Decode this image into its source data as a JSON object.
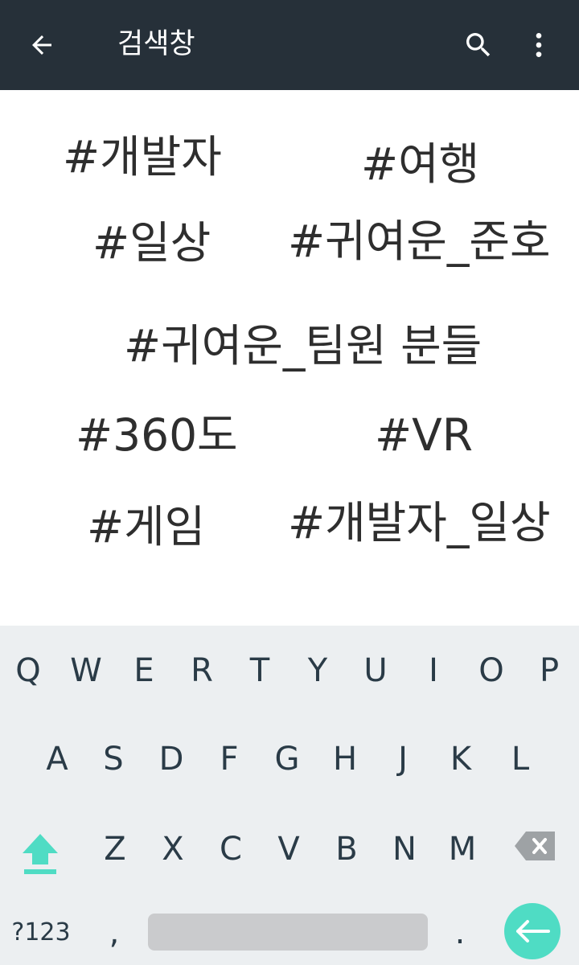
{
  "app_bar": {
    "title": "검색창",
    "back_icon": "arrow-left-icon",
    "search_icon": "search-icon",
    "more_icon": "more-vert-icon",
    "background": "#263039"
  },
  "tags": [
    "#개발자",
    "#여행",
    "#일상",
    "#귀여운_준호",
    "#귀여운_팀원 분들",
    "#360도",
    "#VR",
    "#게임",
    "#개발자_일상"
  ],
  "keyboard": {
    "row1": [
      "Q",
      "W",
      "E",
      "R",
      "T",
      "Y",
      "U",
      "I",
      "O",
      "P"
    ],
    "row2": [
      "A",
      "S",
      "D",
      "F",
      "G",
      "H",
      "J",
      "K",
      "L"
    ],
    "row3": [
      "Z",
      "X",
      "C",
      "V",
      "B",
      "N",
      "M"
    ],
    "symbols_label": "?123",
    "comma": ",",
    "period": ".",
    "shift_icon": "shift-icon",
    "backspace_icon": "backspace-icon",
    "enter_icon": "enter-arrow-icon",
    "accent_color": "#4fdcc4"
  }
}
